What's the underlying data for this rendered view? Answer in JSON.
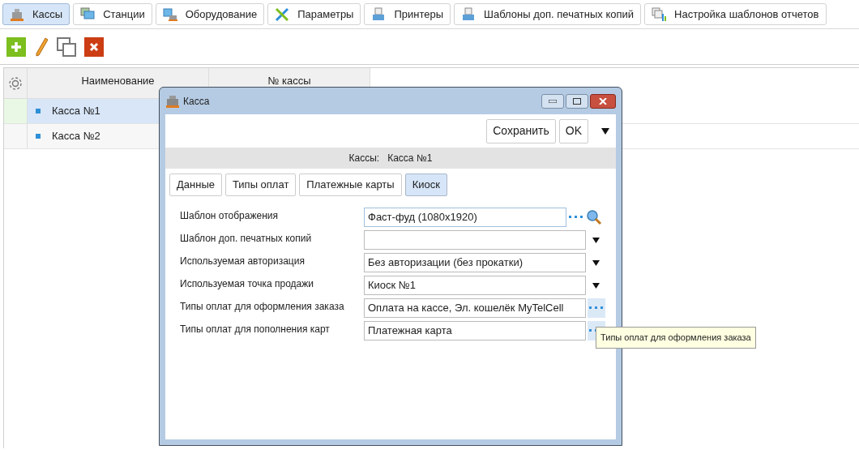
{
  "top_tabs": [
    {
      "label": "Кассы",
      "kind": "register",
      "selected": true
    },
    {
      "label": "Станции",
      "kind": "station",
      "selected": false
    },
    {
      "label": "Оборудование",
      "kind": "equipment",
      "selected": false
    },
    {
      "label": "Параметры",
      "kind": "tools",
      "selected": false
    },
    {
      "label": "Принтеры",
      "kind": "printer",
      "selected": false
    },
    {
      "label": "Шаблоны доп. печатных копий",
      "kind": "printer",
      "selected": false
    },
    {
      "label": "Настройка шаблонов отчетов",
      "kind": "report",
      "selected": false
    }
  ],
  "table": {
    "columns": [
      "Наименование",
      "№ кассы"
    ],
    "rows": [
      {
        "name": "Касса №1",
        "selected": true
      },
      {
        "name": "Касса №2",
        "selected": false
      }
    ]
  },
  "dialog": {
    "title": "Касса",
    "buttons": [
      "Сохранить",
      "OK"
    ],
    "header": {
      "label": "Кассы:",
      "value": "Касса №1"
    },
    "tabs": [
      {
        "label": "Данные",
        "selected": false
      },
      {
        "label": "Типы оплат",
        "selected": false
      },
      {
        "label": "Платежные карты",
        "selected": false
      },
      {
        "label": "Киоск",
        "selected": true
      }
    ],
    "fields": [
      {
        "label": "Шаблон отображения",
        "value": "Фаст-фуд (1080x1920)",
        "kind": "lookup"
      },
      {
        "label": "Шаблон доп. печатных копий",
        "kind": "dropdown"
      },
      {
        "label": "Используемая авторизация",
        "value": "Без авторизации (без прокатки)",
        "kind": "dropdown"
      },
      {
        "label": "Используемая точка продажи",
        "value": "Киоск №1",
        "kind": "dropdown"
      },
      {
        "label": "Типы оплат для оформления заказа",
        "value": "Оплата на кассе, Эл. кошелёк MyTelCell",
        "kind": "multi"
      },
      {
        "label": "Типы оплат для пополнения карт",
        "value": "Платежная карта",
        "kind": "multi"
      }
    ]
  },
  "tooltip": "Типы оплат для оформления заказа"
}
